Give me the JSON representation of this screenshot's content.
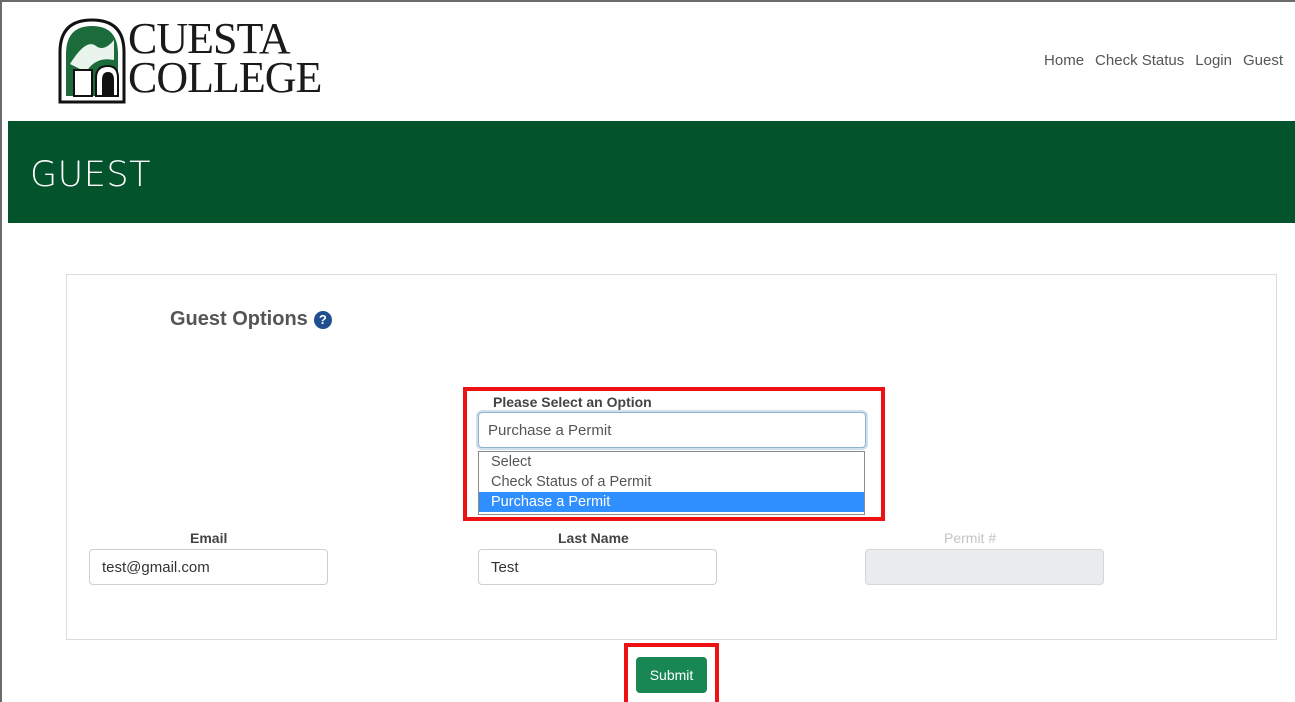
{
  "brand": {
    "line1": "CUESTA",
    "line2": "COLLEGE"
  },
  "nav": [
    "Home",
    "Check Status",
    "Login",
    "Guest"
  ],
  "banner": {
    "title": "GUEST"
  },
  "card": {
    "title": "Guest Options"
  },
  "option_select": {
    "label": "Please Select an Option",
    "value": "Purchase a Permit",
    "options": [
      "Select",
      "Check Status of a Permit",
      "Purchase a Permit"
    ],
    "selected_option": "Purchase a Permit"
  },
  "fields": {
    "email": {
      "label": "Email",
      "value": "test@gmail.com"
    },
    "last_name": {
      "label": "Last Name",
      "value": "Test"
    },
    "permit": {
      "label": "Permit #",
      "value": ""
    }
  },
  "submit": {
    "label": "Submit"
  },
  "colors": {
    "brand_green": "#03532c",
    "button_green": "#198754",
    "highlight_red": "#ee1111",
    "option_highlight": "#2f8fff"
  }
}
